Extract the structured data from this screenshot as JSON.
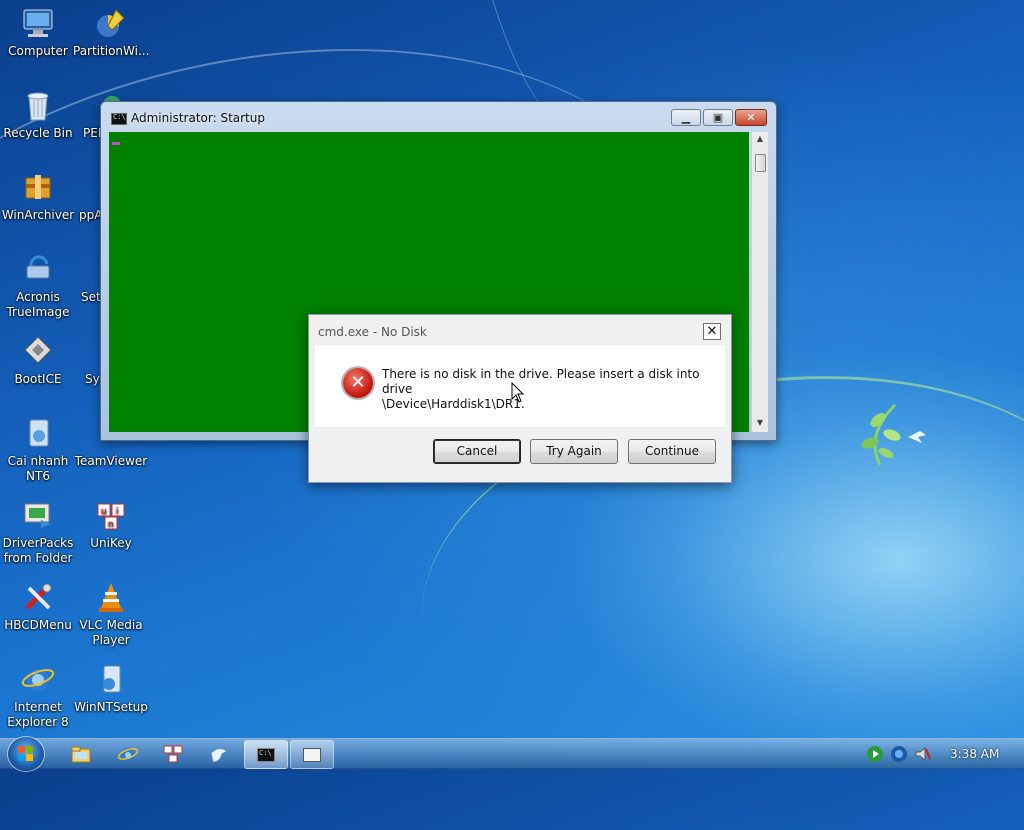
{
  "desktop": {
    "icons": [
      {
        "label": "Computer"
      },
      {
        "label": "PartitionWi..."
      },
      {
        "label": "Recycle Bin"
      },
      {
        "label": "PEN"
      },
      {
        "label": "WinArchiver"
      },
      {
        "label": "ppA"
      },
      {
        "label": "Acronis TrueImage"
      },
      {
        "label": "Set"
      },
      {
        "label": "BootICE"
      },
      {
        "label": "Sy"
      },
      {
        "label": "Cai nhanh NT6"
      },
      {
        "label": "TeamViewer"
      },
      {
        "label": "DriverPacks from Folder"
      },
      {
        "label": "UniKey"
      },
      {
        "label": "HBCDMenu"
      },
      {
        "label": "VLC Media Player"
      },
      {
        "label": "Internet Explorer 8"
      },
      {
        "label": "WinNTSetup"
      }
    ]
  },
  "cmd_window": {
    "title": "Administrator:  Startup",
    "icon_text": "C:\\",
    "console_color": "#008000",
    "buttons": {
      "minimize": "minimize-icon",
      "maximize": "maximize-icon",
      "close": "close-icon"
    }
  },
  "dialog": {
    "title": "cmd.exe - No Disk",
    "message_line1": "There is no disk in the drive. Please insert a disk into drive",
    "message_line2": "\\Device\\Harddisk1\\DR1.",
    "icon": "error-icon",
    "buttons": {
      "cancel": "Cancel",
      "try_again": "Try Again",
      "continue": "Continue"
    },
    "close_glyph": "✕"
  },
  "taskbar": {
    "clock": "3:38 AM",
    "pinned": [
      "explorer-icon",
      "internet-explorer-icon",
      "network-icon",
      "bird-icon"
    ],
    "tasks": [
      "cmd-task",
      "cmd-task-2"
    ]
  },
  "colors": {
    "accent": "#1a75cf",
    "console": "#008000",
    "error": "#c81e14"
  }
}
